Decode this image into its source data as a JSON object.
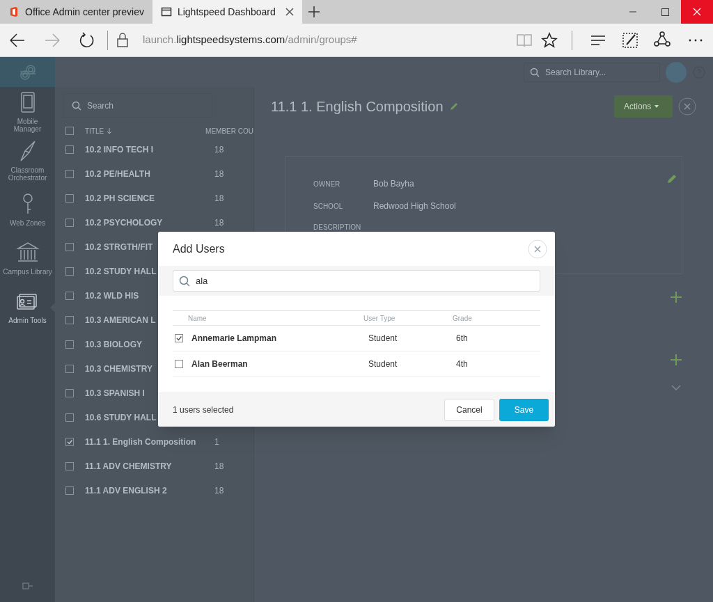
{
  "browser": {
    "tabs": [
      {
        "title": "Office Admin center previev",
        "selected": false,
        "kind": "office"
      },
      {
        "title": "Lightspeed Dashboard",
        "selected": true,
        "kind": "page"
      }
    ],
    "address": {
      "prefix": "launch.",
      "domain": "lightspeedsystems.com",
      "path": "/admin/groups#"
    },
    "forward_disabled": true
  },
  "sidebar": {
    "items": [
      {
        "label": "Mobile Manager",
        "kind": "tablet",
        "selected": false
      },
      {
        "label": "Classroom Orchestrator",
        "kind": "compass",
        "selected": false
      },
      {
        "label": "Web Zones",
        "kind": "key",
        "selected": false
      },
      {
        "label": "Campus Library",
        "kind": "library",
        "selected": false
      },
      {
        "label": "Admin Tools",
        "kind": "admin",
        "selected": true
      }
    ]
  },
  "header": {
    "search_placeholder": "Search Library..."
  },
  "groups": {
    "search_placeholder": "Search",
    "all_checked": false,
    "columns": [
      "TITLE",
      "MEMBER COU"
    ],
    "rows": [
      {
        "title": "10.2 INFO TECH I",
        "count": "18",
        "checked": false
      },
      {
        "title": "10.2 PE/HEALTH",
        "count": "18",
        "checked": false
      },
      {
        "title": "10.2 PH SCIENCE",
        "count": "18",
        "checked": false
      },
      {
        "title": "10.2 PSYCHOLOGY",
        "count": "18",
        "checked": false
      },
      {
        "title": "10.2 STRGTH/FIT",
        "checked": false
      },
      {
        "title": "10.2 STUDY HALL",
        "checked": false
      },
      {
        "title": "10.2 WLD HIS",
        "checked": false
      },
      {
        "title": "10.3 AMERICAN L",
        "checked": false
      },
      {
        "title": "10.3 BIOLOGY",
        "checked": false
      },
      {
        "title": "10.3 CHEMISTRY",
        "checked": false
      },
      {
        "title": "10.3 SPANISH I",
        "checked": false
      },
      {
        "title": "10.6 STUDY HALL",
        "checked": false
      },
      {
        "title": "11.1 1. English Composition",
        "count": "1",
        "checked": true
      },
      {
        "title": "11.1 ADV CHEMISTRY",
        "count": "18",
        "checked": false
      },
      {
        "title": "11.1 ADV ENGLISH 2",
        "count": "18",
        "checked": false
      }
    ]
  },
  "detail": {
    "title": "11.1 1. English Composition",
    "actions_label": "Actions",
    "fields": [
      {
        "label": "OWNER",
        "value": "Bob Bayha"
      },
      {
        "label": "SCHOOL",
        "value": "Redwood High School"
      },
      {
        "label": "DESCRIPTION"
      }
    ]
  },
  "modal": {
    "title": "Add Users",
    "search_value": "ala",
    "columns": [
      "Name",
      "User Type",
      "Grade"
    ],
    "rows": [
      {
        "name": "Annemarie Lampman",
        "user_type": "Student",
        "grade": "6th",
        "checked": true
      },
      {
        "name": "Alan Beerman",
        "user_type": "Student",
        "grade": "4th",
        "checked": false
      }
    ],
    "footer_text": "1 users selected",
    "buttons": [
      "Cancel",
      "Save"
    ]
  }
}
